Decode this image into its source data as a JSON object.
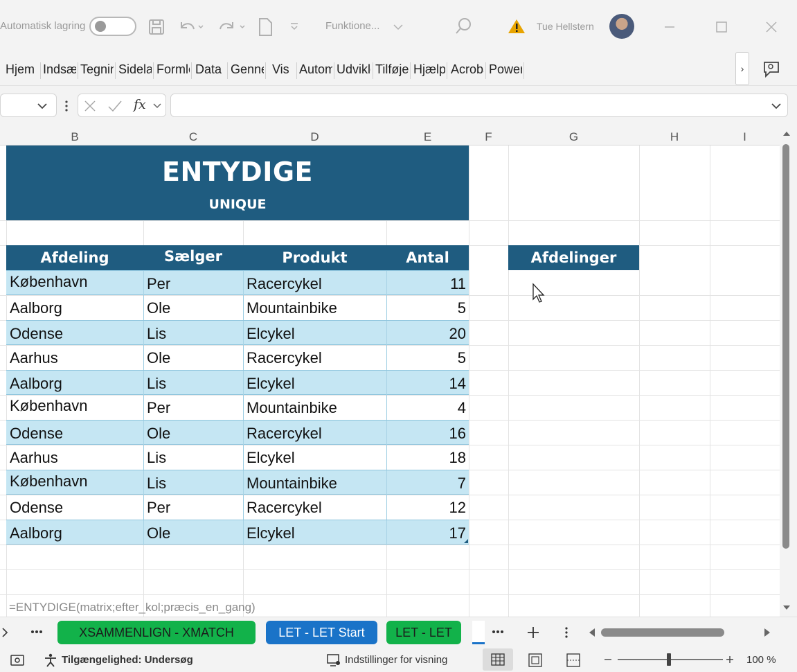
{
  "titlebar": {
    "autosave_label": "Automatisk lagring",
    "filename": "Funktione...",
    "user": "Tue Hellstern",
    "warning_icon": "warning-icon",
    "colors": {
      "warning": "#e8a400"
    }
  },
  "ribbon": {
    "tabs": [
      "Hjem",
      "Indsæt",
      "Tegning",
      "Sidelayout",
      "Formler",
      "Data",
      "Gennemse",
      "Vis",
      "Automatiser",
      "Udvikler",
      "Tilføjelsesprogrammer",
      "Hjælp",
      "Acrobat",
      "Power Pivot"
    ],
    "more_label": "›"
  },
  "formula_bar": {
    "fx_label": "fx",
    "value": ""
  },
  "columns": [
    "B",
    "C",
    "D",
    "E",
    "F",
    "G",
    "H",
    "I"
  ],
  "sheet": {
    "banner_title": "ENTYDIGE",
    "banner_subtitle": "UNIQUE",
    "headers": [
      "Afdeling",
      "Sælger",
      "Produkt",
      "Antal"
    ],
    "rows": [
      [
        "København",
        "Per",
        "Racercykel",
        "11"
      ],
      [
        "Aalborg",
        "Ole",
        "Mountainbike",
        "5"
      ],
      [
        "Odense",
        "Lis",
        "Elcykel",
        "20"
      ],
      [
        "Aarhus",
        "Ole",
        "Racercykel",
        "5"
      ],
      [
        "Aalborg",
        "Lis",
        "Elcykel",
        "14"
      ],
      [
        "København",
        "Per",
        "Mountainbike",
        "4"
      ],
      [
        "Odense",
        "Ole",
        "Racercykel",
        "16"
      ],
      [
        "Aarhus",
        "Lis",
        "Elcykel",
        "18"
      ],
      [
        "København",
        "Lis",
        "Mountainbike",
        "7"
      ],
      [
        "Odense",
        "Per",
        "Racercykel",
        "12"
      ],
      [
        "Aalborg",
        "Ole",
        "Elcykel",
        "17"
      ]
    ],
    "side_header": "Afdelinger",
    "formula_hint": "=ENTYDIGE(matrix;efter_kol;præcis_en_gang)",
    "colors": {
      "header": "#1f5c80",
      "band": "#c5e6f3"
    }
  },
  "sheet_tabs": [
    {
      "label": "XSAMMENLIGN - XMATCH",
      "color": "#12b24a"
    },
    {
      "label": "LET - LET Start",
      "color": "#1a73c8"
    },
    {
      "label": "LET - LET",
      "color": "#12b24a"
    }
  ],
  "status": {
    "accessibility": "Tilgængelighed: Undersøg",
    "display_settings": "Indstillinger for visning",
    "zoom": "100 %"
  }
}
